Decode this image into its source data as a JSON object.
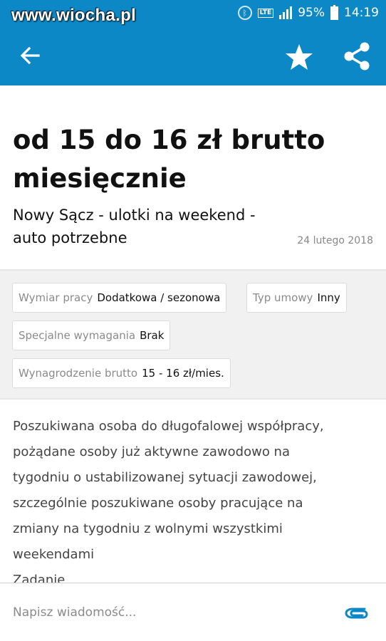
{
  "status_bar": {
    "watermark": "www.wiocha.pl",
    "network": "LTE",
    "battery": "95%",
    "time": "14:19",
    "icons": [
      "bluetooth-icon",
      "lte-icon",
      "signal-icon",
      "battery-icon"
    ]
  },
  "app_bar": {
    "color": "#0d88c6",
    "icons": [
      "back-arrow-icon",
      "star-icon",
      "share-icon"
    ]
  },
  "listing": {
    "title": "od 15 do 16 zł brutto miesięcznie",
    "subtitle": "Nowy Sącz - ulotki na weekend - auto potrzebne",
    "date": "24 lutego 2018"
  },
  "attributes": [
    {
      "key": "Wymiar pracy",
      "value": "Dodatkowa / sezonowa"
    },
    {
      "key": "Typ umowy",
      "value": "Inny"
    },
    {
      "key": "Specjalne wymagania",
      "value": "Brak"
    },
    {
      "key": "Wynagrodzenie brutto",
      "value": "15 - 16 zł/mies."
    }
  ],
  "description": {
    "lines": [
      "Poszukiwana osoba do długofalowej współpracy,",
      "pożądane osoby już aktywne zawodowo na",
      "tygodniu o ustabilizowanej sytuacji zawodowej,",
      "szczególnie poszukiwane osoby pracujące na",
      "zmiany na tygodniu z wolnymi wszystkimi",
      "weekendami",
      "Zadanie"
    ]
  },
  "composer": {
    "placeholder": "Napisz wiadomość...",
    "value": ""
  }
}
